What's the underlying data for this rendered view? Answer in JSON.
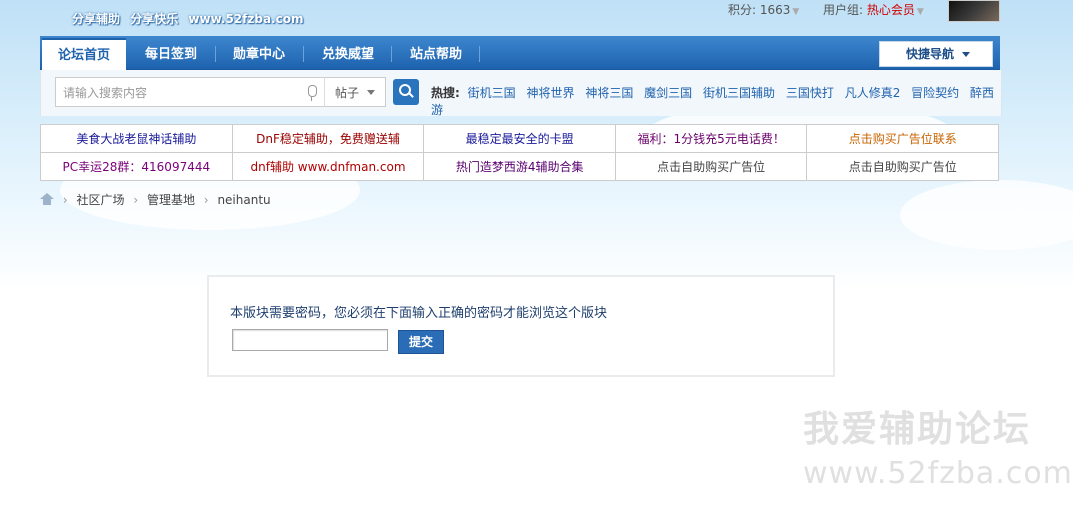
{
  "header": {
    "logo_tagline": [
      "分享辅助",
      "分享快乐",
      "www.52fzba.com"
    ],
    "user": {
      "points_label": "积分: 1663",
      "group_label": "用户组:",
      "group_value": "热心会员"
    }
  },
  "nav": {
    "tabs": [
      {
        "label": "论坛首页",
        "active": true
      },
      {
        "label": "每日签到",
        "active": false
      },
      {
        "label": "勋章中心",
        "active": false
      },
      {
        "label": "兑换威望",
        "active": false
      },
      {
        "label": "站点帮助",
        "active": false
      }
    ],
    "quick_nav": "快捷导航"
  },
  "search": {
    "placeholder": "请输入搜索内容",
    "type_selected": "帖子",
    "hot_label": "热搜:",
    "hot_terms": [
      "街机三国",
      "神将世界",
      "神将三国",
      "魔剑三国",
      "街机三国辅助",
      "三国快打",
      "凡人修真2",
      "冒险契约",
      "醉西游"
    ]
  },
  "ads": {
    "rows": [
      [
        {
          "text": "美食大战老鼠神话辅助",
          "color": "#1a1a9a"
        },
        {
          "text": "DnF稳定辅助，免费赠送辅",
          "color": "#9a0000"
        },
        {
          "text": "最稳定最安全的卡盟",
          "color": "#1a1a9a"
        },
        {
          "text": "福利：1分钱充5元电话费！",
          "color": "#6a006a"
        },
        {
          "text": "点击购买广告位联系",
          "color": "#c86400"
        }
      ],
      [
        {
          "text": "PC幸运28群：416097444",
          "color": "#7a007a"
        },
        {
          "text": "dnf辅助 www.dnfman.com",
          "color": "#b00000"
        },
        {
          "text": "热门造梦西游4辅助合集",
          "color": "#5a0070"
        },
        {
          "text": "点击自助购买广告位",
          "color": "#444444"
        },
        {
          "text": "点击自助购买广告位",
          "color": "#444444"
        }
      ]
    ]
  },
  "breadcrumb": [
    "社区广场",
    "管理基地",
    "neihantu"
  ],
  "password_prompt": {
    "message": "本版块需要密码，您必须在下面输入正确的密码才能浏览这个版块",
    "value": "",
    "submit_label": "提交"
  },
  "watermark": {
    "line1": "我爱辅助论坛",
    "line2": "www.52fzba.com"
  }
}
